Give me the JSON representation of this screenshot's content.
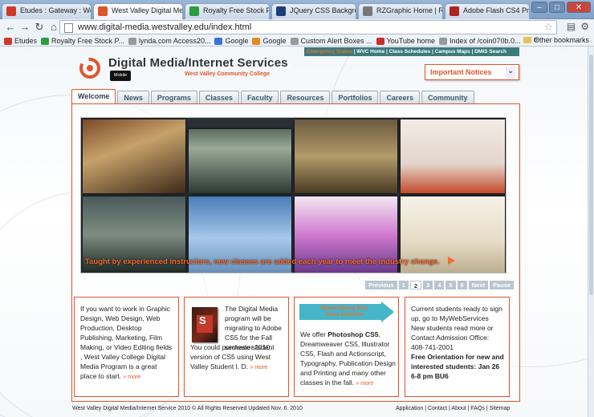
{
  "browser": {
    "tabs": [
      {
        "title": "Etudes : Gateway : Welc...",
        "fav": "#cc3a2a"
      },
      {
        "title": "West Valley Digital Med...",
        "fav": "#e0552a",
        "active": true
      },
      {
        "title": "Royalty Free Stock Phot...",
        "fav": "#2f9b3f"
      },
      {
        "title": "JQuery CSS Backgroun...",
        "fav": "#1d3c7a"
      },
      {
        "title": "RZGraphic Home | Rebe...",
        "fav": "#777777"
      },
      {
        "title": "Adobe Flash CS4 Profes...",
        "fav": "#b3231e"
      }
    ],
    "url": "www.digital-media.westvalley.edu/index.html",
    "bookmarks": [
      {
        "label": "Etudes",
        "color": "#cc3a2a"
      },
      {
        "label": "Royalty Free Stock P...",
        "color": "#2f9b3f"
      },
      {
        "label": "lynda.com Access20...",
        "color": "#999999"
      },
      {
        "label": "Google",
        "color": "#3a72d8"
      },
      {
        "label": "Google",
        "color": "#e38a1f"
      },
      {
        "label": "Custom Alert Boxes ...",
        "color": "#999999"
      },
      {
        "label": "YouTube home",
        "color": "#c4302b"
      },
      {
        "label": "Index of /coin070b.0...",
        "color": "#999999"
      }
    ],
    "other_bookmarks": "Other bookmarks"
  },
  "site": {
    "title": "Digital Media/Internet Services",
    "college": "West Valley Community College",
    "mobile": "Mobile Site",
    "emergency": "Emergency Status",
    "toplinks": " | WVC Home | Class Schedules | Campus Maps | DMIS Search",
    "important": "Important Notices",
    "tabs": [
      "Welcome",
      "News",
      "Programs",
      "Classes",
      "Faculty",
      "Resources",
      "Portfolios",
      "Careers",
      "Community"
    ],
    "caption": "Taught by experienced instructors, new classes are added each year to meet the industry change.",
    "pager": {
      "previous": "Previous",
      "pages": [
        "1",
        "2",
        "3",
        "4",
        "5",
        "6"
      ],
      "active": "2",
      "next": "Next",
      "pause": "Pause"
    },
    "box1": {
      "text": "If you want to work in Graphic Design, Web Design, Web Production, Desktop Publishing, Marketing, Film Making, or Video Editing fields , West Valley College Digital Media Program is a great place to start.",
      "more": "» more"
    },
    "box2": {
      "logo_letter": "S",
      "text_a": "The Digital Media program will be migrating to Adobe CS5 for the Fall semester 2010.",
      "text_b": "You could purchase student version of CS5 using West Valley Student I. D.",
      "more": "» more"
    },
    "box3": {
      "arrow_line1": "Winter/Spring 2011",
      "arrow_line2": "Class Schedule",
      "text_pre": "We offer ",
      "text_bold": "Photoshop CS5",
      "text_post": ", Dreamweaver CS5, Illustrator CS5, Flash and Actionscript, Typography, Publication Design and Printing and many other classes in the fall.",
      "more": "» more"
    },
    "box4": {
      "text": "Current students ready to sign up, go to MyWebServices New students read more or Contact Admission Office: 408-741-2001",
      "bold": "Free Orientation for new and interested students: Jan 26 6-8 pm BU6"
    },
    "footer": {
      "copyright": "West Valley Digital Media/Internet Service 2010 © All Rights Reserved Updated Nov. 6. 2010",
      "links": "Application | Contact | About | FAQs | Sitemap"
    }
  }
}
